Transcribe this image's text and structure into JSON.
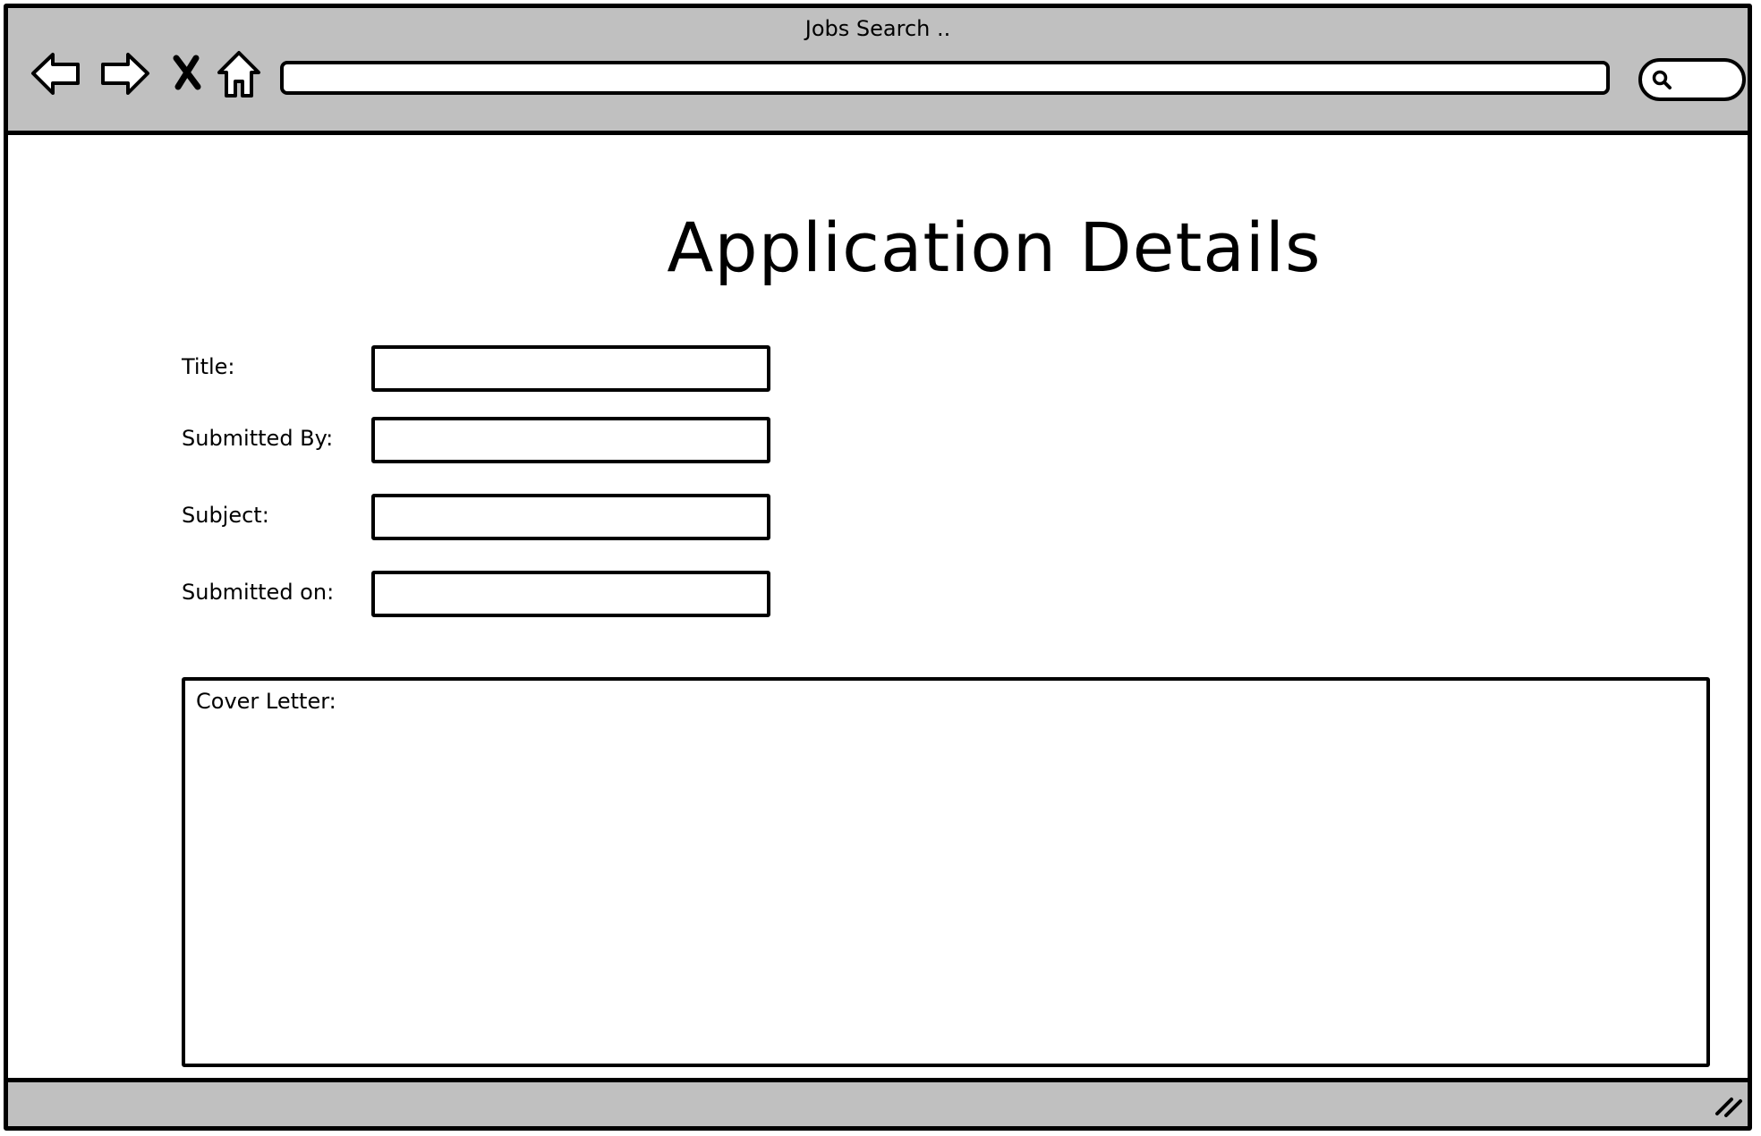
{
  "window": {
    "title": "Jobs Search .."
  },
  "toolbar": {
    "back_icon": "back-arrow-icon",
    "forward_icon": "forward-arrow-icon",
    "stop_icon": "close-icon",
    "home_icon": "home-icon",
    "address_value": "",
    "search_icon": "search-icon"
  },
  "page": {
    "title": "Application Details"
  },
  "form": {
    "fields": [
      {
        "label": "Title:",
        "value": ""
      },
      {
        "label": "Submitted By:",
        "value": ""
      },
      {
        "label": "Subject:",
        "value": ""
      },
      {
        "label": "Submitted on:",
        "value": ""
      }
    ],
    "cover_letter": {
      "label": "Cover Letter:",
      "value": ""
    }
  },
  "colors": {
    "chrome": "#c0c0c0",
    "border": "#000000",
    "background": "#ffffff"
  }
}
